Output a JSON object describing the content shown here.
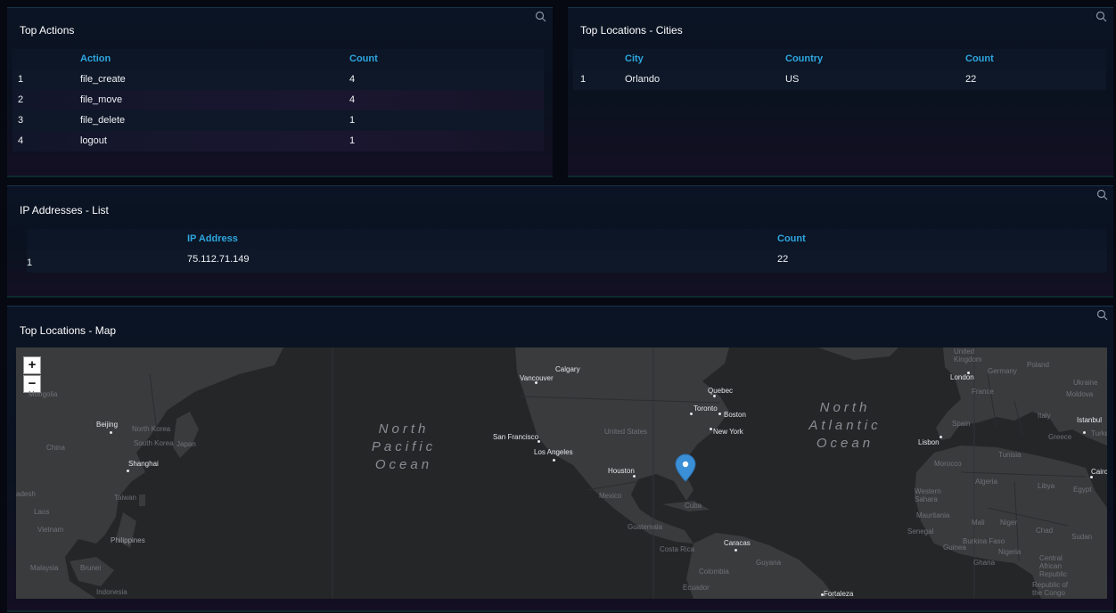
{
  "top_actions": {
    "title": "Top Actions",
    "headers": {
      "action": "Action",
      "count": "Count"
    },
    "rows": [
      {
        "rank": "1",
        "action": "file_create",
        "count": "4"
      },
      {
        "rank": "2",
        "action": "file_move",
        "count": "4"
      },
      {
        "rank": "3",
        "action": "file_delete",
        "count": "1"
      },
      {
        "rank": "4",
        "action": "logout",
        "count": "1"
      }
    ]
  },
  "top_cities": {
    "title": "Top Locations - Cities",
    "headers": {
      "city": "City",
      "country": "Country",
      "count": "Count"
    },
    "rows": [
      {
        "rank": "1",
        "city": "Orlando",
        "country": "US",
        "count": "22"
      }
    ]
  },
  "ip_list": {
    "title": "IP Addresses - List",
    "headers": {
      "ip": "IP Address",
      "count": "Count"
    },
    "rows": [
      {
        "rank": "1",
        "ip": "75.112.71.149",
        "count": "22"
      }
    ]
  },
  "map_panel": {
    "title": "Top Locations - Map",
    "zoom_in": "+",
    "zoom_out": "−",
    "oceans": {
      "north_pacific": [
        "North",
        "Pacific",
        "Ocean"
      ],
      "north_atlantic": [
        "North",
        "Atlantic",
        "Ocean"
      ]
    },
    "labels": {
      "united_kingdom": "United Kingdom",
      "london": "London",
      "germany": "Germany",
      "poland": "Poland",
      "ukraine": "Ukraine",
      "france": "France",
      "moldova": "Moldova",
      "spain": "Spain",
      "italy": "Italy",
      "istanbul": "Istanbul",
      "turkey": "Turke",
      "greece": "Greece",
      "lisbon": "Lisbon",
      "morocco": "Morocco",
      "tunisia": "Tunisia",
      "algeria": "Algeria",
      "libya": "Libya",
      "egypt": "Egypt",
      "cairo": "Cairo",
      "western_sahara": "Western Sahara",
      "mauritania": "Mauritania",
      "mali": "Mali",
      "niger": "Niger",
      "chad": "Chad",
      "sudan": "Sudan",
      "senegal": "Senegal",
      "burkina_faso": "Burkina Faso",
      "guinea": "Guinea",
      "ghana": "Ghana",
      "nigeria": "Nigeria",
      "car": "Central African Republic",
      "congo": "Republic of the Congo",
      "mongolia": "Mongolia",
      "beijing": "Beijing",
      "north_korea": "North Korea",
      "south_korea": "South Korea",
      "japan": "Japan",
      "china": "China",
      "shanghai": "Shanghai",
      "taiwan": "Taiwan",
      "laos": "Laos",
      "vietnam": "Vietnam",
      "philippines": "Philippines",
      "malaysia": "Malaysia",
      "brunei": "Brunei",
      "indonesia": "Indonesia",
      "bangladesh": "adesh",
      "vancouver": "Vancouver",
      "calgary": "Calgary",
      "quebec": "Quebec",
      "toronto": "Toronto",
      "boston": "Boston",
      "new_york": "New York",
      "united_states": "United States",
      "san_francisco": "San Francisco",
      "los_angeles": "Los Angeles",
      "houston": "Houston",
      "mexico": "Mexico",
      "cuba": "Cuba",
      "guatemala": "Guatemala",
      "costa_rica": "Costa Rica",
      "caracas": "Caracas",
      "guyana": "Guyana",
      "colombia": "Colombia",
      "ecuador": "Ecuador",
      "fortaleza": "Fortaleza"
    },
    "marker": {
      "city": "Orlando",
      "color": "#3b8fd6"
    }
  },
  "colors": {
    "header_accent": "#2ea6e0",
    "background": "#060912",
    "map_land": "#3a3b3d",
    "map_water": "#252628"
  }
}
